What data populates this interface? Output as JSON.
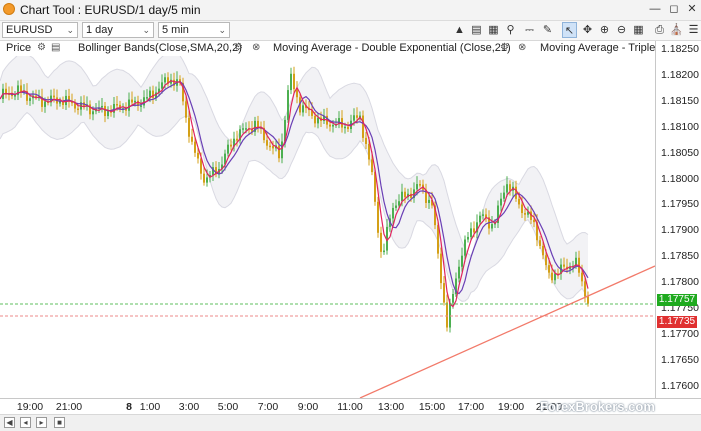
{
  "window": {
    "title": "Chart Tool : EURUSD/1 day/5 min"
  },
  "toolbar": {
    "symbol": "EURUSD",
    "period": "1 day",
    "interval": "5 min",
    "icons": [
      "chart-type-icon",
      "indicators-icon",
      "studies-icon",
      "zoom-icon",
      "delete-icon",
      "draw-icon",
      "select-cursor-icon",
      "crosshair-icon",
      "zoom-in-icon",
      "zoom-out-icon",
      "grid-icon",
      "print-icon",
      "bank-icon"
    ]
  },
  "legend": {
    "price": "Price",
    "bollinger": "Bollinger Bands(Close,SMA,20,2)",
    "dema": "Moving Average - Double Exponential (Close,21)",
    "tema": "Moving Average - Triple"
  },
  "price_tags": [
    {
      "value": "1.17757",
      "color": "#1faa1f"
    },
    {
      "value": "1.17735",
      "color": "#e03030"
    }
  ],
  "y_ticks": [
    "1.18250",
    "1.18200",
    "1.18150",
    "1.18100",
    "1.18050",
    "1.18000",
    "1.17950",
    "1.17900",
    "1.17850",
    "1.17800",
    "1.17750",
    "1.17700",
    "1.17650",
    "1.17600"
  ],
  "x_ticks": [
    "19:00",
    "21:00",
    "8",
    "1:00",
    "3:00",
    "5:00",
    "7:00",
    "9:00",
    "11:00",
    "13:00",
    "15:00",
    "17:00",
    "19:00",
    "21:00"
  ],
  "watermark": "ForexBrokers.com",
  "colors": {
    "bull": "#4caf50",
    "bear": "#d4a017",
    "ma1": "#e0245e",
    "ma2": "#6a3fb5",
    "band": "#e9e9ee",
    "trend": "#f27a6a"
  }
}
